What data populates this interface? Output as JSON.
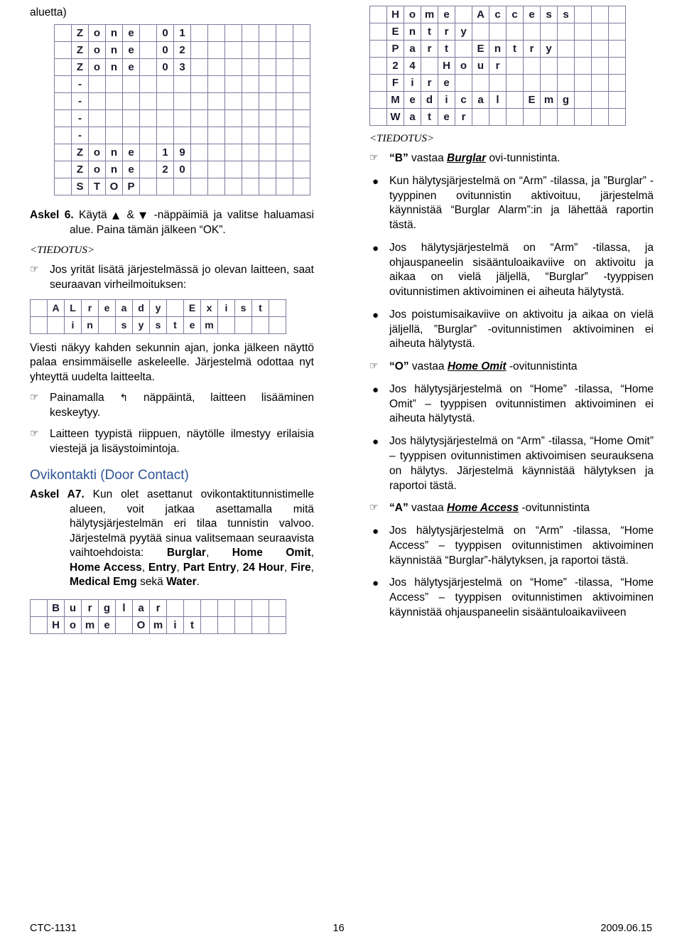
{
  "page": {
    "left_top_fragment": "aluetta)",
    "footer": {
      "left": "CTC-1131",
      "center": "16",
      "right": "2009.06.15"
    }
  },
  "left": {
    "lcd_zones": {
      "name": "zone-list-display",
      "rows": [
        [
          "",
          "Z",
          "o",
          "n",
          "e",
          "",
          "0",
          "1",
          "",
          "",
          "",
          "",
          "",
          "",
          ""
        ],
        [
          "",
          "Z",
          "o",
          "n",
          "e",
          "",
          "0",
          "2",
          "",
          "",
          "",
          "",
          "",
          "",
          ""
        ],
        [
          "",
          "Z",
          "o",
          "n",
          "e",
          "",
          "0",
          "3",
          "",
          "",
          "",
          "",
          "",
          "",
          ""
        ],
        [
          "",
          "-",
          "",
          "",
          "",
          "",
          "",
          "",
          "",
          "",
          "",
          "",
          "",
          "",
          ""
        ],
        [
          "",
          "-",
          "",
          "",
          "",
          "",
          "",
          "",
          "",
          "",
          "",
          "",
          "",
          "",
          ""
        ],
        [
          "",
          "-",
          "",
          "",
          "",
          "",
          "",
          "",
          "",
          "",
          "",
          "",
          "",
          "",
          ""
        ],
        [
          "",
          "-",
          "",
          "",
          "",
          "",
          "",
          "",
          "",
          "",
          "",
          "",
          "",
          "",
          ""
        ],
        [
          "",
          "Z",
          "o",
          "n",
          "e",
          "",
          "1",
          "9",
          "",
          "",
          "",
          "",
          "",
          "",
          ""
        ],
        [
          "",
          "Z",
          "o",
          "n",
          "e",
          "",
          "2",
          "0",
          "",
          "",
          "",
          "",
          "",
          "",
          ""
        ],
        [
          "",
          "S",
          "T",
          "O",
          "P",
          "",
          "",
          "",
          "",
          "",
          "",
          "",
          "",
          "",
          ""
        ]
      ]
    },
    "step6": {
      "label": "Askel 6.",
      "text_before_up": "Käytä",
      "up_arrow": "▲",
      "amp": "&",
      "down_arrow": "▼",
      "text_after": "-näppäimiä ja valitse haluamasi alue. Paina tämän jälkeen “OK”."
    },
    "tiedotus_tag": "<TIEDOTUS>",
    "note_already_exist": {
      "glyph": "☞",
      "text": "Jos yrität lisätä järjestelmässä jo olevan laitteen, saat seuraavan virheilmoituksen:"
    },
    "lcd_already": {
      "name": "already-exist-display",
      "rows": [
        [
          "",
          "A",
          "L",
          "r",
          "e",
          "a",
          "d",
          "y",
          "",
          "E",
          "x",
          "i",
          "s",
          "t",
          ""
        ],
        [
          "",
          "",
          "i",
          "n",
          "",
          "s",
          "y",
          "s",
          "t",
          "e",
          "m",
          "",
          "",
          "",
          ""
        ]
      ]
    },
    "para_message": "Viesti näkyy kahden sekunnin ajan, jonka jälkeen näyttö palaa ensimmäiselle askeleelle. Järjestelmä odottaa nyt yhteyttä uudelta laitteelta.",
    "note_cancel": {
      "glyph": "☞",
      "text_before": "Painamalla",
      "key": "↰",
      "text_after": "näppäintä, laitteen lisääminen keskeytyy."
    },
    "note_messages": {
      "glyph": "☞",
      "text": "Laitteen tyypistä riippuen, näytölle ilmestyy erilaisia viestejä ja lisäystoimintoja."
    },
    "door_contact_heading": "Ovikontakti (Door Contact)",
    "stepA7": {
      "label": "Askel A7.",
      "text": "Kun olet asettanut ovikontaktitunnistimelle alueen, voit jatkaa asettamalla mitä hälytysjärjestelmän eri tilaa tunnistin valvoo. Järjestelmä pyytää sinua valitsemaan seuraavista vaihtoehdoista:",
      "options": [
        "Burglar",
        "Home Omit",
        "Home Access",
        "Entry",
        "Part Entry",
        "24 Hour",
        "Fire",
        "Medical Emg"
      ],
      "tail": "sekä",
      "last_option": "Water",
      "period": "."
    },
    "lcd_burglar": {
      "name": "burglar-home-omit-display",
      "rows": [
        [
          "",
          "B",
          "u",
          "r",
          "g",
          "l",
          "a",
          "r",
          "",
          "",
          "",
          "",
          "",
          "",
          ""
        ],
        [
          "",
          "H",
          "o",
          "m",
          "e",
          "",
          "O",
          "m",
          "i",
          "t",
          "",
          "",
          "",
          "",
          ""
        ]
      ]
    }
  },
  "right": {
    "lcd_options": {
      "name": "alarm-type-options-display",
      "rows": [
        [
          "",
          "H",
          "o",
          "m",
          "e",
          "",
          "A",
          "c",
          "c",
          "e",
          "s",
          "s",
          "",
          "",
          ""
        ],
        [
          "",
          "E",
          "n",
          "t",
          "r",
          "y",
          "",
          "",
          "",
          "",
          "",
          "",
          "",
          "",
          ""
        ],
        [
          "",
          "P",
          "a",
          "r",
          "t",
          "",
          "E",
          "n",
          "t",
          "r",
          "y",
          "",
          "",
          "",
          ""
        ],
        [
          "",
          "2",
          "4",
          "",
          "H",
          "o",
          "u",
          "r",
          "",
          "",
          "",
          "",
          "",
          "",
          ""
        ],
        [
          "",
          "F",
          "i",
          "r",
          "e",
          "",
          "",
          "",
          "",
          "",
          "",
          "",
          "",
          "",
          ""
        ],
        [
          "",
          "M",
          "e",
          "d",
          "i",
          "c",
          "a",
          "l",
          "",
          "E",
          "m",
          "g",
          "",
          "",
          ""
        ],
        [
          "",
          "W",
          "a",
          "t",
          "e",
          "r",
          "",
          "",
          "",
          "",
          "",
          "",
          "",
          "",
          ""
        ]
      ]
    },
    "tiedotus_tag": "<TIEDOTUS>",
    "b_answer": {
      "glyph": "☞",
      "pre": "“B”",
      "mid": "vastaa",
      "em": "Burglar",
      "post": "ovi-tunnistinta."
    },
    "bullets_burglar": [
      "Kun hälytysjärjestelmä on “Arm” -tilassa, ja ”Burglar” -tyyppinen ovitunnistin aktivoituu, järjestelmä käynnistää “Burglar Alarm”:in ja lähettää raportin tästä.",
      "Jos hälytysjärjestelmä on “Arm” -tilassa, ja ohjauspaneelin sisääntuloaikaviive on aktivoitu ja aikaa on vielä jäljellä, “Burglar” -tyyppisen ovitunnistimen aktivoiminen ei aiheuta hälytystä.",
      "Jos poistumisaikaviive on aktivoitu ja aikaa on vielä jäljellä, ”Burglar” -ovitunnistimen aktivoiminen ei aiheuta hälytystä."
    ],
    "o_answer": {
      "glyph": "☞",
      "pre": "“O”",
      "mid": "vastaa",
      "em": "Home Omit",
      "post": "-ovitunnistinta"
    },
    "bullets_home_omit": [
      "Jos hälytysjärjestelmä on “Home” -tilassa, “Home Omit” – tyyppisen ovitunnistimen aktivoiminen ei aiheuta hälytystä.",
      "Jos hälytysjärjestelmä on “Arm” -tilassa, “Home Omit” – tyyppisen ovitunnistimen aktivoimisen seurauksena on hälytys. Järjestelmä käynnistää hälytyksen ja raportoi tästä."
    ],
    "a_answer": {
      "glyph": "☞",
      "pre": "“A”",
      "mid": "vastaa",
      "em": "Home Access",
      "post": "-ovitunnistinta"
    },
    "bullets_home_access": [
      "Jos hälytysjärjestelmä on “Arm” -tilassa, “Home Access” – tyyppisen ovitunnistimen aktivoiminen käynnistää “Burglar”-hälytyksen, ja raportoi tästä.",
      "Jos hälytysjärjestelmä on “Home” -tilassa, “Home Access” – tyyppisen ovitunnistimen aktivoiminen käynnistää ohjauspaneelin sisääntuloaikaviiveen"
    ]
  }
}
